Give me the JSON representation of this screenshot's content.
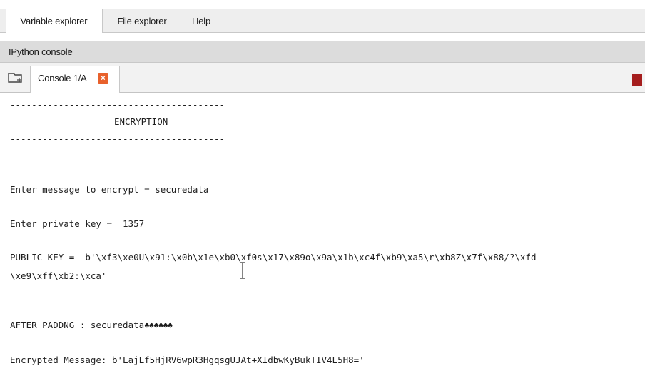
{
  "top_tabs": {
    "variable_explorer": "Variable explorer",
    "file_explorer": "File explorer",
    "help": "Help"
  },
  "panel_title": "IPython console",
  "console_tab": {
    "label": "Console 1/A",
    "close_glyph": "×"
  },
  "icons": {
    "new_console": "folder-icon",
    "close": "close-icon",
    "stop": "stop-icon",
    "cursor": "text-cursor-icon"
  },
  "colors": {
    "close_button": "#e8612c",
    "stop_button": "#a51e1e"
  },
  "console": {
    "separator_top": "----------------------------------------",
    "title": "ENCRYPTION",
    "separator_bottom": "----------------------------------------",
    "message_prompt": "Enter message to encrypt = securedata",
    "key_prompt": "Enter private key =  1357",
    "public_key_line1": "PUBLIC KEY =  b'\\xf3\\xe0U\\x91:\\x0b\\x1e\\xb0\\xf0s\\x17\\x89o\\x9a\\x1b\\xc4f\\xb9\\xa5\\r\\xb8Z\\x7f\\x88/?\\xfd",
    "public_key_line2": "\\xe9\\xff\\xb2:\\xca'",
    "padding_label": "AFTER PADDNG : securedata",
    "padding_marks": "♠♠♠♠♠♠",
    "encrypted_message": "Encrypted Message: b'LajLf5HjRV6wpR3HgqsgUJAt+XIdbwKyBukTIV4L5H8='"
  }
}
